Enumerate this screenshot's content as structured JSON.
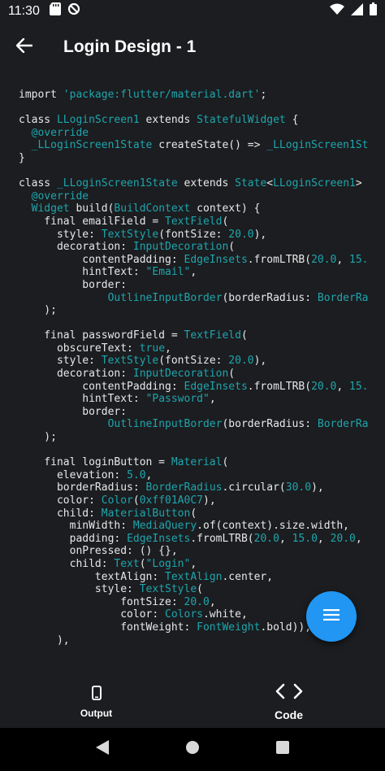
{
  "status_bar": {
    "time": "11:30",
    "left_icons": [
      "sd-card-icon",
      "data-saver-icon"
    ],
    "right_icons": [
      "wifi-icon",
      "cell-signal-icon",
      "battery-icon"
    ]
  },
  "app_bar": {
    "title": "Login Design - 1",
    "back_icon": "arrow-back-icon"
  },
  "code": {
    "lines": [
      [
        [
          "import ",
          "kw"
        ],
        [
          "'package:flutter/material.dart'",
          "str"
        ],
        [
          ";",
          "kw"
        ]
      ],
      [],
      [
        [
          "class ",
          "kw"
        ],
        [
          "LLoginScreen1",
          "type"
        ],
        [
          " extends ",
          "kw"
        ],
        [
          "StatefulWidget",
          "type"
        ],
        [
          " {",
          "kw"
        ]
      ],
      [
        [
          "  @override",
          "type"
        ]
      ],
      [
        [
          "  _LLoginScreen1State",
          "type"
        ],
        [
          " createState() => ",
          "kw"
        ],
        [
          "_LLoginScreen1St",
          "type"
        ]
      ],
      [
        [
          "}",
          "kw"
        ]
      ],
      [],
      [
        [
          "class ",
          "kw"
        ],
        [
          "_LLoginScreen1State",
          "type"
        ],
        [
          " extends ",
          "kw"
        ],
        [
          "State",
          "type"
        ],
        [
          "<",
          "kw"
        ],
        [
          "LLoginScreen1",
          "type"
        ],
        [
          ">",
          "kw"
        ]
      ],
      [
        [
          "  @override",
          "type"
        ]
      ],
      [
        [
          "  Widget",
          "type"
        ],
        [
          " build(",
          "kw"
        ],
        [
          "BuildContext",
          "type"
        ],
        [
          " context) {",
          "kw"
        ]
      ],
      [
        [
          "    final emailField = ",
          "kw"
        ],
        [
          "TextField",
          "type"
        ],
        [
          "(",
          "kw"
        ]
      ],
      [
        [
          "      style: ",
          "kw"
        ],
        [
          "TextStyle",
          "type"
        ],
        [
          "(fontSize: ",
          "kw"
        ],
        [
          "20.0",
          "num"
        ],
        [
          "),",
          "kw"
        ]
      ],
      [
        [
          "      decoration: ",
          "kw"
        ],
        [
          "InputDecoration",
          "type"
        ],
        [
          "(",
          "kw"
        ]
      ],
      [
        [
          "          contentPadding: ",
          "kw"
        ],
        [
          "EdgeInsets",
          "type"
        ],
        [
          ".fromLTRB(",
          "kw"
        ],
        [
          "20.0",
          "num"
        ],
        [
          ", ",
          "kw"
        ],
        [
          "15.",
          "num"
        ]
      ],
      [
        [
          "          hintText: ",
          "kw"
        ],
        [
          "\"Email\"",
          "str"
        ],
        [
          ",",
          "kw"
        ]
      ],
      [
        [
          "          border:",
          "kw"
        ]
      ],
      [
        [
          "              ",
          "kw"
        ],
        [
          "OutlineInputBorder",
          "type"
        ],
        [
          "(borderRadius: ",
          "kw"
        ],
        [
          "BorderRa",
          "type"
        ]
      ],
      [
        [
          "    );",
          "kw"
        ]
      ],
      [],
      [
        [
          "    final passwordField = ",
          "kw"
        ],
        [
          "TextField",
          "type"
        ],
        [
          "(",
          "kw"
        ]
      ],
      [
        [
          "      obscureText: ",
          "kw"
        ],
        [
          "true",
          "num"
        ],
        [
          ",",
          "kw"
        ]
      ],
      [
        [
          "      style: ",
          "kw"
        ],
        [
          "TextStyle",
          "type"
        ],
        [
          "(fontSize: ",
          "kw"
        ],
        [
          "20.0",
          "num"
        ],
        [
          "),",
          "kw"
        ]
      ],
      [
        [
          "      decoration: ",
          "kw"
        ],
        [
          "InputDecoration",
          "type"
        ],
        [
          "(",
          "kw"
        ]
      ],
      [
        [
          "          contentPadding: ",
          "kw"
        ],
        [
          "EdgeInsets",
          "type"
        ],
        [
          ".fromLTRB(",
          "kw"
        ],
        [
          "20.0",
          "num"
        ],
        [
          ", ",
          "kw"
        ],
        [
          "15.",
          "num"
        ]
      ],
      [
        [
          "          hintText: ",
          "kw"
        ],
        [
          "\"Password\"",
          "str"
        ],
        [
          ",",
          "kw"
        ]
      ],
      [
        [
          "          border:",
          "kw"
        ]
      ],
      [
        [
          "              ",
          "kw"
        ],
        [
          "OutlineInputBorder",
          "type"
        ],
        [
          "(borderRadius: ",
          "kw"
        ],
        [
          "BorderRa",
          "type"
        ]
      ],
      [
        [
          "    );",
          "kw"
        ]
      ],
      [],
      [
        [
          "    final loginButton = ",
          "kw"
        ],
        [
          "Material",
          "type"
        ],
        [
          "(",
          "kw"
        ]
      ],
      [
        [
          "      elevation: ",
          "kw"
        ],
        [
          "5.0",
          "num"
        ],
        [
          ",",
          "kw"
        ]
      ],
      [
        [
          "      borderRadius: ",
          "kw"
        ],
        [
          "BorderRadius",
          "type"
        ],
        [
          ".circular(",
          "kw"
        ],
        [
          "30.0",
          "num"
        ],
        [
          "),",
          "kw"
        ]
      ],
      [
        [
          "      color: ",
          "kw"
        ],
        [
          "Color",
          "type"
        ],
        [
          "(",
          "kw"
        ],
        [
          "0xff01A0C7",
          "num"
        ],
        [
          "),",
          "kw"
        ]
      ],
      [
        [
          "      child: ",
          "kw"
        ],
        [
          "MaterialButton",
          "type"
        ],
        [
          "(",
          "kw"
        ]
      ],
      [
        [
          "        minWidth: ",
          "kw"
        ],
        [
          "MediaQuery",
          "type"
        ],
        [
          ".of(context).size.width,",
          "kw"
        ]
      ],
      [
        [
          "        padding: ",
          "kw"
        ],
        [
          "EdgeInsets",
          "type"
        ],
        [
          ".fromLTRB(",
          "kw"
        ],
        [
          "20.0",
          "num"
        ],
        [
          ", ",
          "kw"
        ],
        [
          "15.0",
          "num"
        ],
        [
          ", ",
          "kw"
        ],
        [
          "20.0",
          "num"
        ],
        [
          ",",
          "kw"
        ]
      ],
      [
        [
          "        onPressed: () {},",
          "kw"
        ]
      ],
      [
        [
          "        child: ",
          "kw"
        ],
        [
          "Text",
          "type"
        ],
        [
          "(",
          "kw"
        ],
        [
          "\"Login\"",
          "str"
        ],
        [
          ",",
          "kw"
        ]
      ],
      [
        [
          "            textAlign: ",
          "kw"
        ],
        [
          "TextAlign",
          "type"
        ],
        [
          ".center,",
          "kw"
        ]
      ],
      [
        [
          "            style: ",
          "kw"
        ],
        [
          "TextStyle",
          "type"
        ],
        [
          "(",
          "kw"
        ]
      ],
      [
        [
          "                fontSize: ",
          "kw"
        ],
        [
          "20.0",
          "num"
        ],
        [
          ",",
          "kw"
        ]
      ],
      [
        [
          "                color: ",
          "kw"
        ],
        [
          "Colors",
          "type"
        ],
        [
          ".white,",
          "kw"
        ]
      ],
      [
        [
          "                fontWeight: ",
          "kw"
        ],
        [
          "FontWeight",
          "type"
        ],
        [
          ".bold)),",
          "kw"
        ]
      ],
      [
        [
          "      ),",
          "kw"
        ]
      ]
    ]
  },
  "fab": {
    "icon": "menu-icon",
    "color": "#2196f3"
  },
  "bottom_nav": {
    "output_label": "Output",
    "code_label": "Code"
  },
  "colors": {
    "background": "#1b1d20",
    "code_text": "#e8e8e8",
    "code_accent": "#1fa5ad"
  }
}
